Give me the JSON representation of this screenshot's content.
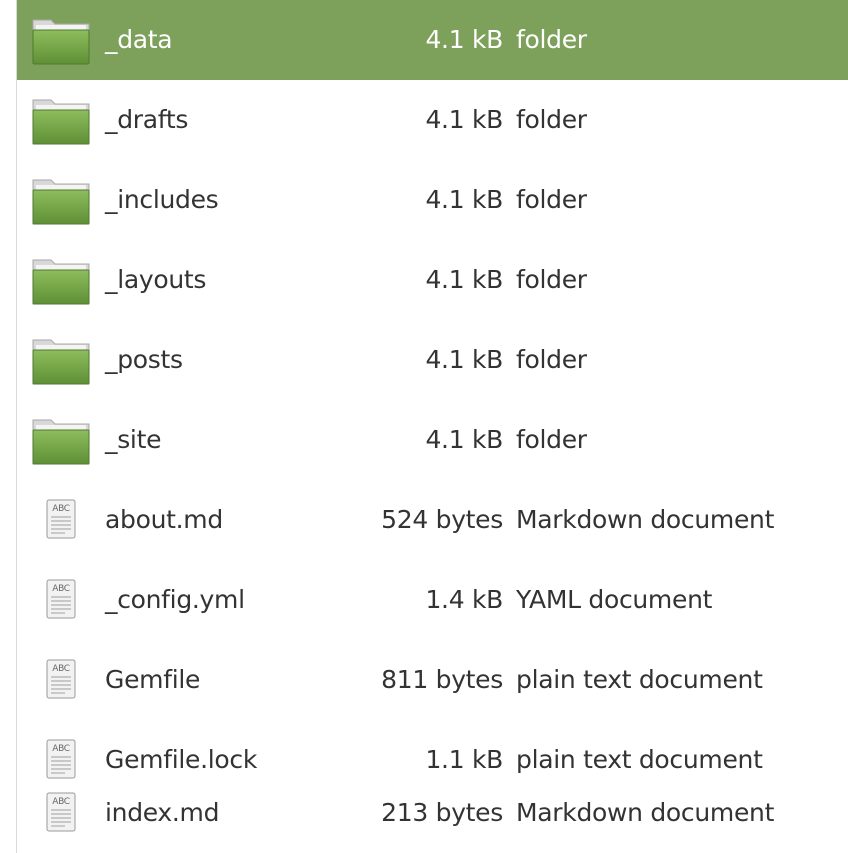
{
  "files": [
    {
      "name": "_data",
      "size": "4.1 kB",
      "type": "folder",
      "icon": "folder-icon",
      "selected": true
    },
    {
      "name": "_drafts",
      "size": "4.1 kB",
      "type": "folder",
      "icon": "folder-icon",
      "selected": false
    },
    {
      "name": "_includes",
      "size": "4.1 kB",
      "type": "folder",
      "icon": "folder-icon",
      "selected": false
    },
    {
      "name": "_layouts",
      "size": "4.1 kB",
      "type": "folder",
      "icon": "folder-icon",
      "selected": false
    },
    {
      "name": "_posts",
      "size": "4.1 kB",
      "type": "folder",
      "icon": "folder-icon",
      "selected": false
    },
    {
      "name": "_site",
      "size": "4.1 kB",
      "type": "folder",
      "icon": "folder-icon",
      "selected": false
    },
    {
      "name": "about.md",
      "size": "524 bytes",
      "type": "Markdown document",
      "icon": "text-document-icon",
      "selected": false
    },
    {
      "name": "_config.yml",
      "size": "1.4 kB",
      "type": "YAML document",
      "icon": "text-document-icon",
      "selected": false
    },
    {
      "name": "Gemfile",
      "size": "811 bytes",
      "type": "plain text document",
      "icon": "text-document-icon",
      "selected": false
    },
    {
      "name": "Gemfile.lock",
      "size": "1.1 kB",
      "type": "plain text document",
      "icon": "text-document-icon",
      "selected": false
    },
    {
      "name": "index.md",
      "size": "213 bytes",
      "type": "Markdown document",
      "icon": "text-document-icon",
      "selected": false
    }
  ],
  "icon_label": "ABC",
  "colors": {
    "selection": "#7da05b",
    "folder_green": "#78a84a",
    "text": "#333333"
  }
}
